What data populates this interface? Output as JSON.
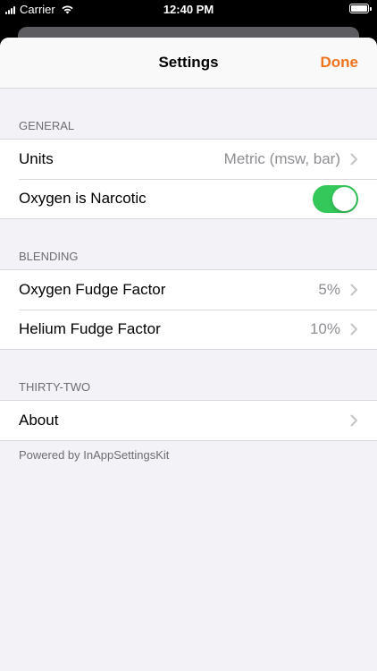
{
  "status_bar": {
    "carrier": "Carrier",
    "time": "12:40 PM",
    "wifi_icon": "wifi-icon",
    "battery_level": 1.0
  },
  "nav": {
    "title": "Settings",
    "done_label": "Done",
    "accent_color": "#f0731e"
  },
  "sections": {
    "general": {
      "header": "GENERAL",
      "units_label": "Units",
      "units_value": "Metric (msw, bar)",
      "oxygen_narcotic_label": "Oxygen is Narcotic",
      "oxygen_narcotic_on": true,
      "toggle_color": "#34c759"
    },
    "blending": {
      "header": "BLENDING",
      "oxygen_fudge_label": "Oxygen Fudge Factor",
      "oxygen_fudge_value": "5%",
      "helium_fudge_label": "Helium Fudge Factor",
      "helium_fudge_value": "10%"
    },
    "thirty_two": {
      "header": "THIRTY-TWO",
      "about_label": "About"
    }
  },
  "footer": {
    "text": "Powered by InAppSettingsKit"
  },
  "icons": {
    "chevron": "chevron-right-icon"
  }
}
